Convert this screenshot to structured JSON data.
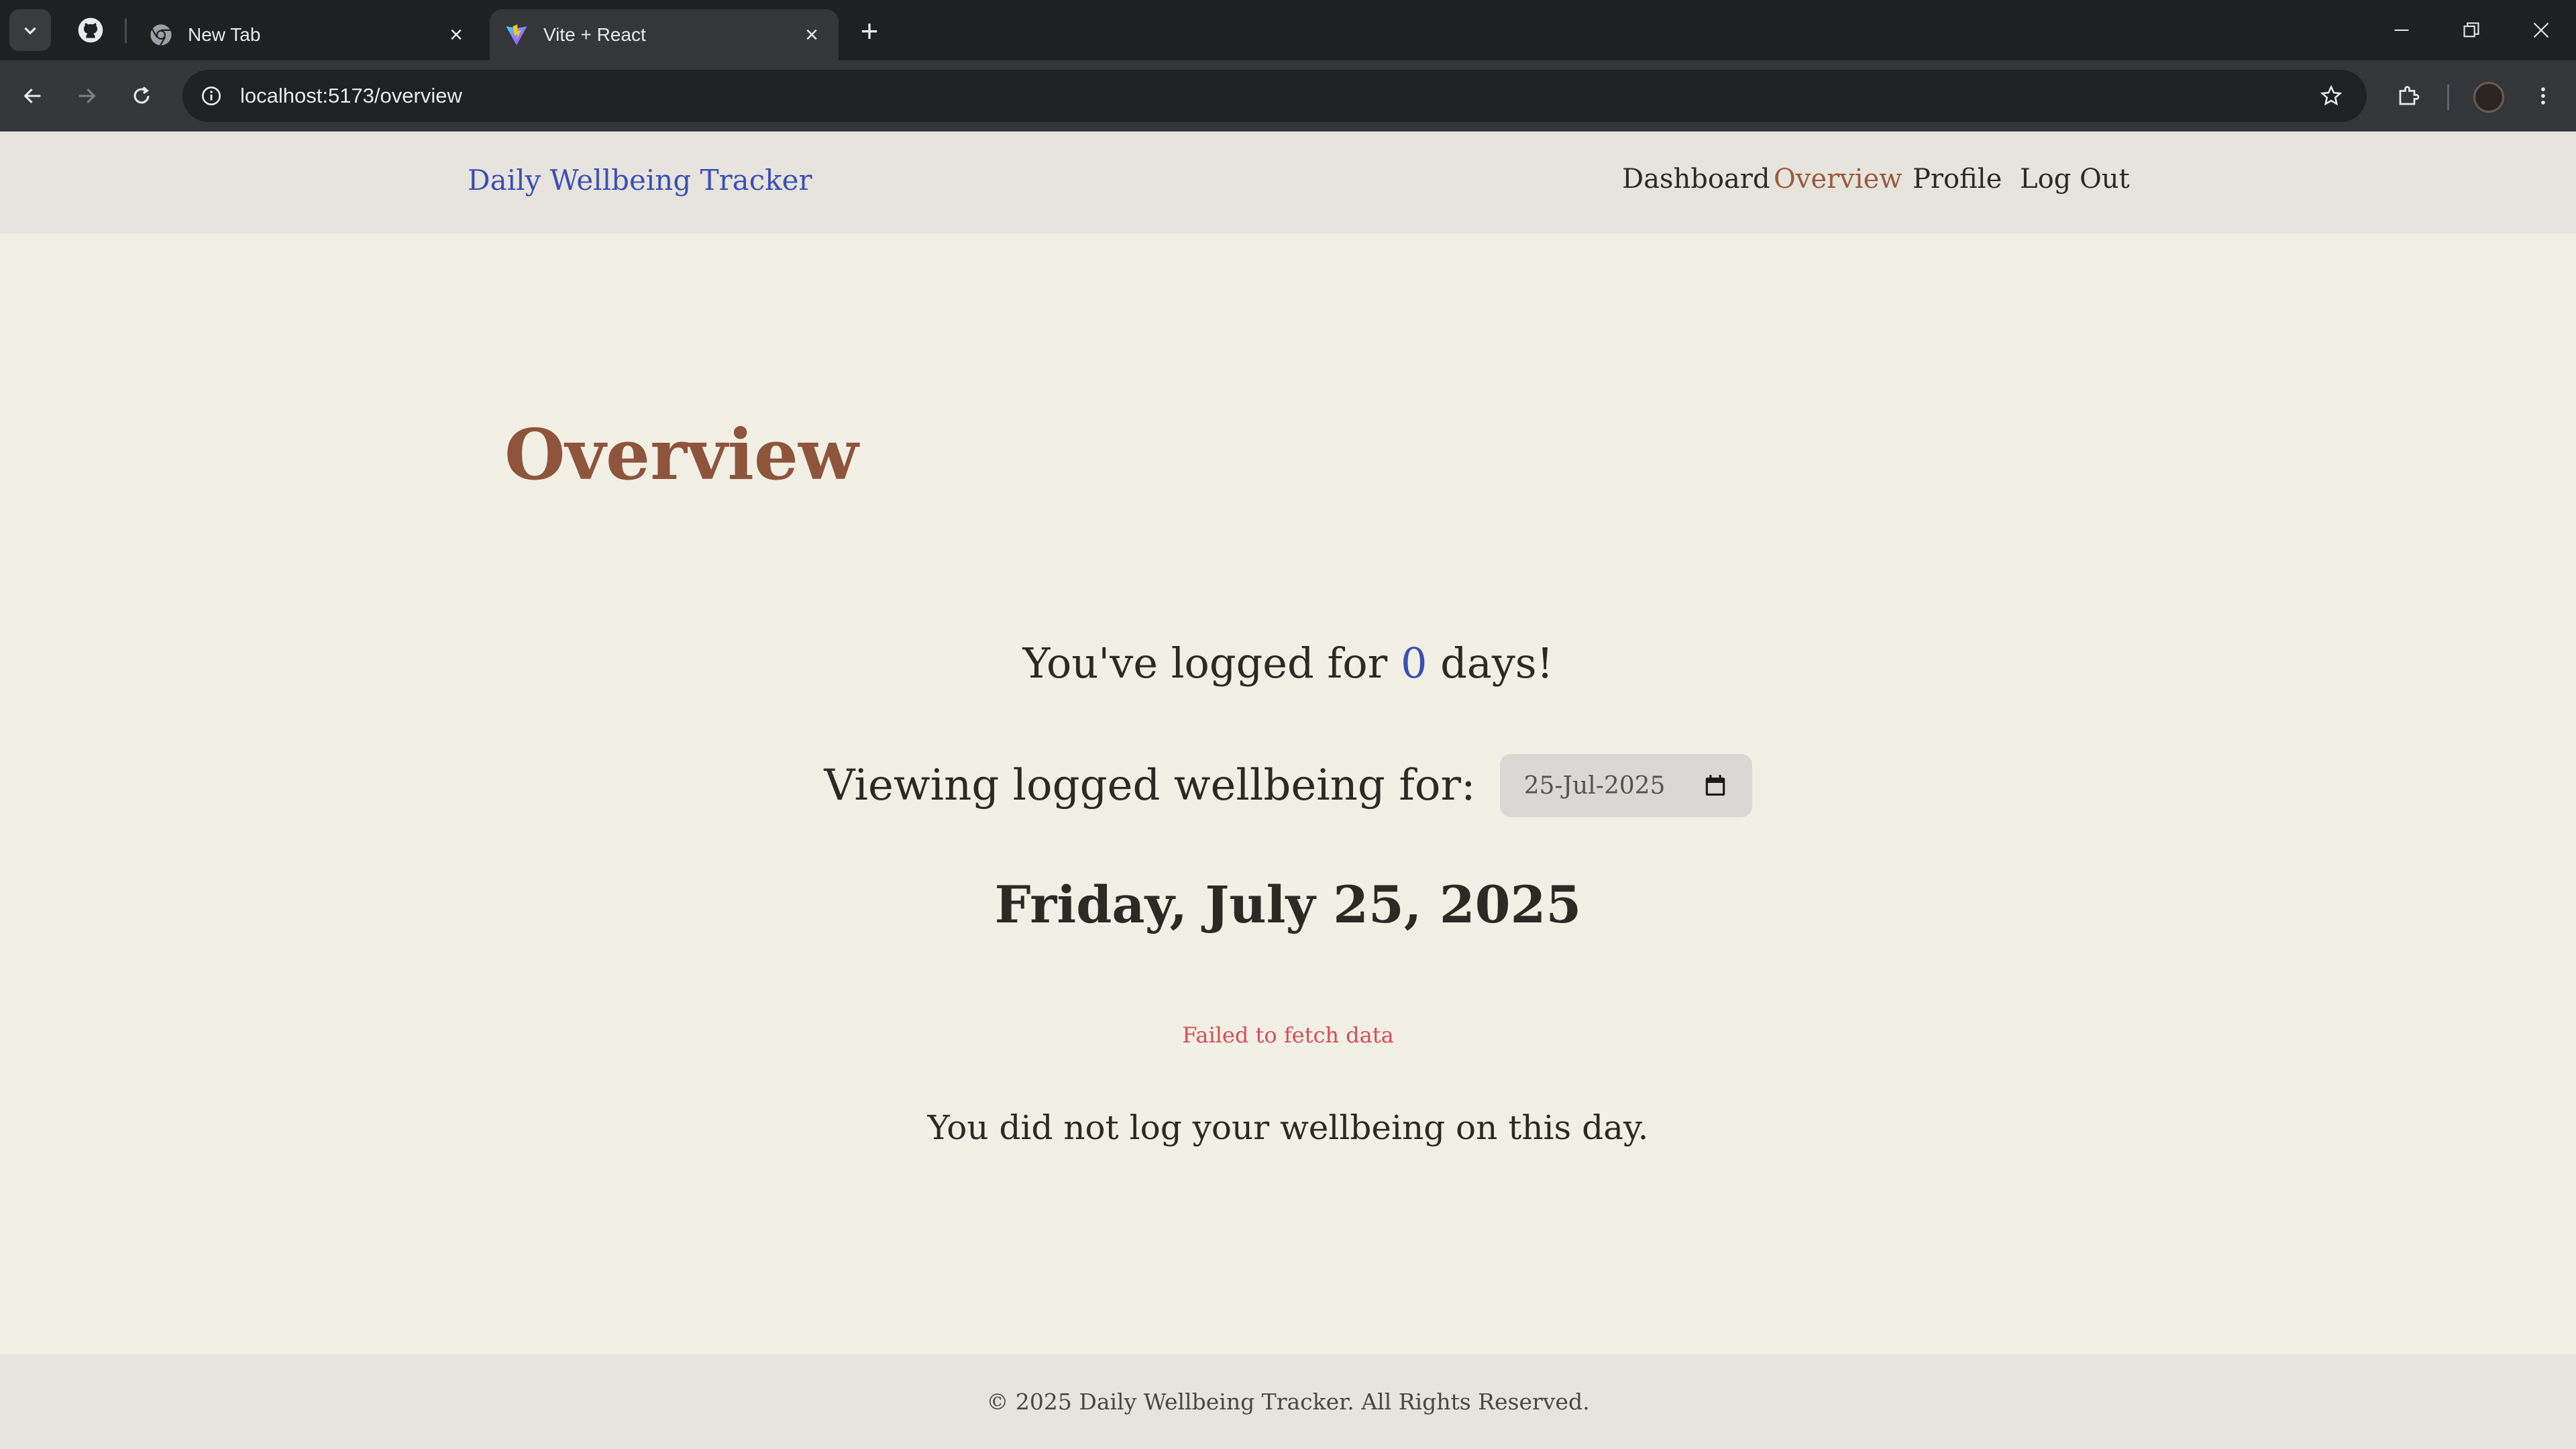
{
  "browser": {
    "tabs": [
      {
        "title": "New Tab",
        "icon": "chrome-icon"
      },
      {
        "title": "Vite + React",
        "icon": "vite-icon",
        "active": true
      }
    ],
    "pinned_tab_icon": "github-icon",
    "url": "localhost:5173/overview"
  },
  "header": {
    "brand": "Daily Wellbeing Tracker",
    "nav": {
      "dashboard": "Dashboard",
      "overview": "Overview",
      "profile": "Profile",
      "logout": "Log Out"
    },
    "active_color": "#9a5a3e",
    "brand_color": "#3c4fb8"
  },
  "main": {
    "title": "Overview",
    "logged_prefix": "You've logged for ",
    "logged_count": "0",
    "logged_suffix": " days!",
    "viewing_label": "Viewing logged wellbeing for:",
    "date_value": "25-Jul-2025",
    "day_heading": "Friday, July 25, 2025",
    "error": "Failed to fetch data",
    "no_log_message": "You did not log your wellbeing on this day."
  },
  "footer": {
    "text": "© 2025 Daily Wellbeing Tracker. All Rights Reserved."
  }
}
